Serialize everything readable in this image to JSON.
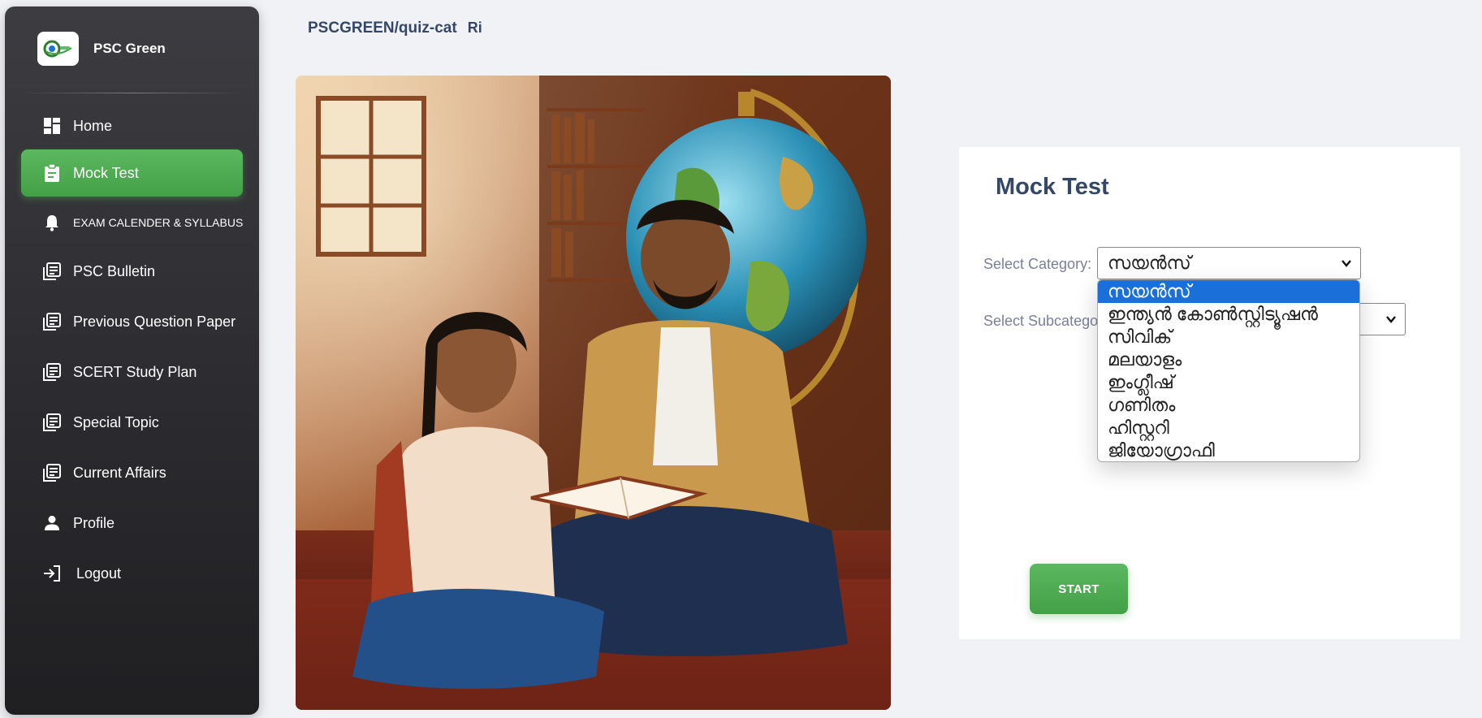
{
  "brand": {
    "name": "PSC Green",
    "logo_icon": "psc-green-logo"
  },
  "sidebar": {
    "items": [
      {
        "label": "Home",
        "icon": "dashboard-icon",
        "active": false
      },
      {
        "label": "Mock Test",
        "icon": "clipboard-icon",
        "active": true
      },
      {
        "label": "EXAM CALENDER & SYLLABUS",
        "icon": "bell-icon",
        "active": false
      },
      {
        "label": "PSC Bulletin",
        "icon": "newspaper-icon",
        "active": false
      },
      {
        "label": "Previous Question Paper",
        "icon": "newspaper-icon",
        "active": false
      },
      {
        "label": "SCERT Study Plan",
        "icon": "newspaper-icon",
        "active": false
      },
      {
        "label": "Special Topic",
        "icon": "newspaper-icon",
        "active": false
      },
      {
        "label": "Current Affairs",
        "icon": "newspaper-icon",
        "active": false
      },
      {
        "label": "Profile",
        "icon": "person-icon",
        "active": false
      },
      {
        "label": "Logout",
        "icon": "login-icon",
        "active": false
      }
    ]
  },
  "header": {
    "breadcrumb": "PSCGREEN/quiz-cat",
    "extra": "Ri"
  },
  "hero": {
    "alt": "students-studying-with-globe"
  },
  "card": {
    "title": "Mock Test",
    "category_label": "Select Category:",
    "category_value": "സയൻസ്",
    "subcategory_label": "Select Subcategory:",
    "subcategory_value": "",
    "start_label": "START"
  },
  "dropdown": {
    "options": [
      "സയൻസ്",
      "ഇന്ത്യൻ കോൺസ്റ്റിട്യൂഷൻ",
      "സിവിക്",
      "മലയാളം",
      "ഇംഗ്ലീഷ്",
      "ഗണിതം",
      "ഹിസ്റ്ററി",
      "ജിയോഗ്രാഫി"
    ],
    "selected_index": 0
  },
  "colors": {
    "accent": "#4caf50",
    "title": "#344767",
    "selection": "#1a6fd8"
  }
}
